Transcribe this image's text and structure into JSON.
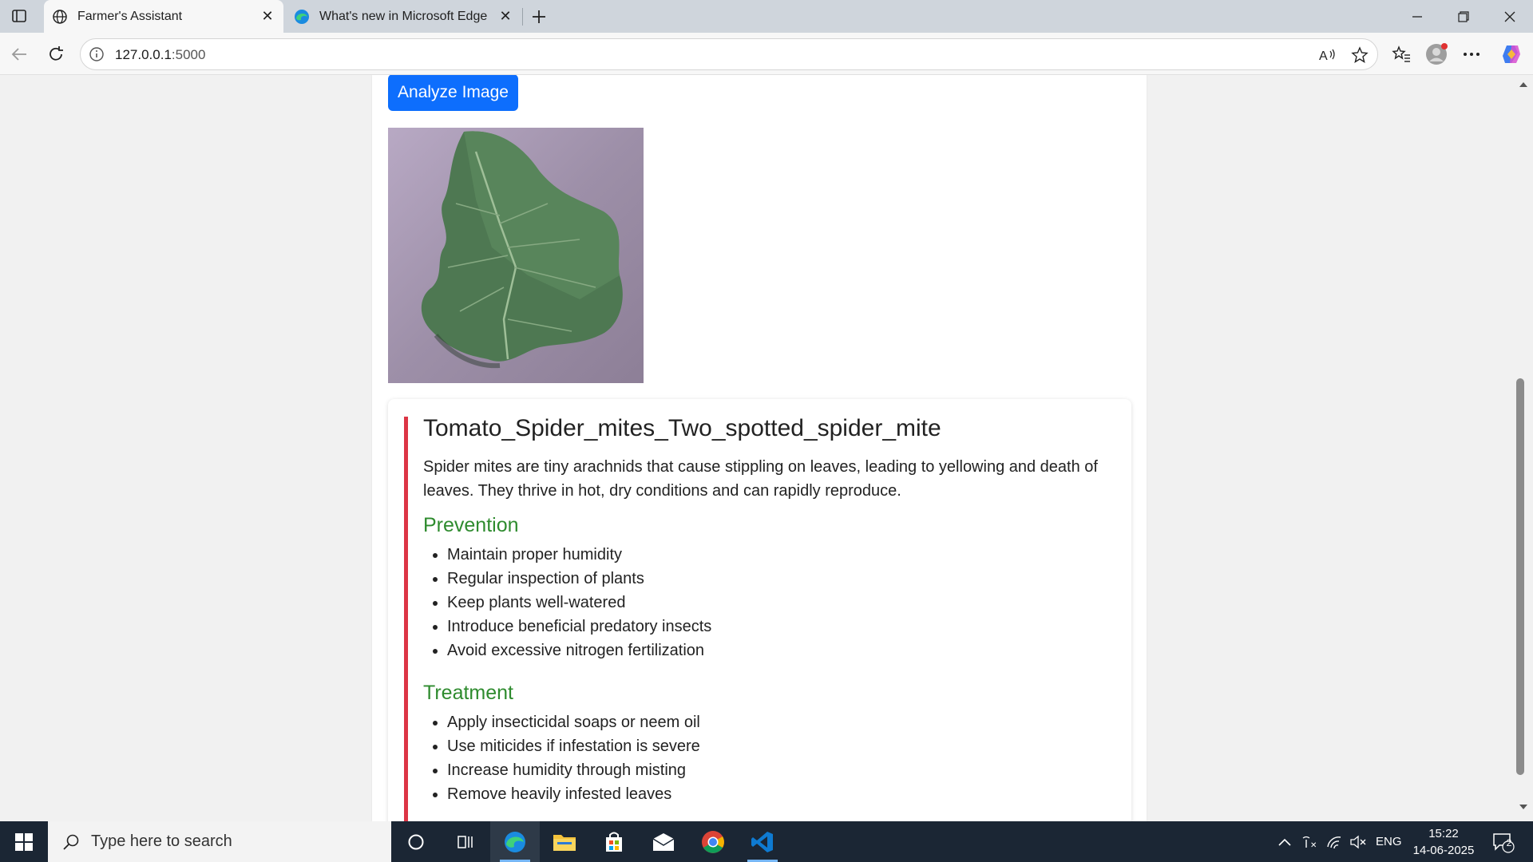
{
  "browser": {
    "tabs": [
      {
        "title": "Farmer's Assistant",
        "active": true,
        "icon": "globe-icon"
      },
      {
        "title": "What's new in Microsoft Edge",
        "active": false,
        "icon": "edge-icon"
      }
    ],
    "address": {
      "host": "127.0.0.1",
      "port": ":5000"
    }
  },
  "page": {
    "analyze_button": "Analyze Image",
    "leaf_image": "leaf-photo",
    "result": {
      "title": "Tomato_Spider_mites_Two_spotted_spider_mite",
      "description": "Spider mites are tiny arachnids that cause stippling on leaves, leading to yellowing and death of leaves. They thrive in hot, dry conditions and can rapidly reproduce.",
      "prevention_title": "Prevention",
      "prevention": [
        "Maintain proper humidity",
        "Regular inspection of plants",
        "Keep plants well-watered",
        "Introduce beneficial predatory insects",
        "Avoid excessive nitrogen fertilization"
      ],
      "treatment_title": "Treatment",
      "treatment": [
        "Apply insecticidal soaps or neem oil",
        "Use miticides if infestation is severe",
        "Increase humidity through misting",
        "Remove heavily infested leaves"
      ]
    },
    "colors": {
      "primary": "#0d6efd",
      "danger": "#dc3545",
      "section": "#2e8b2e"
    }
  },
  "taskbar": {
    "search_placeholder": "Type here to search",
    "language": "ENG",
    "time": "15:22",
    "date": "14-06-2025",
    "notifications": "2"
  }
}
